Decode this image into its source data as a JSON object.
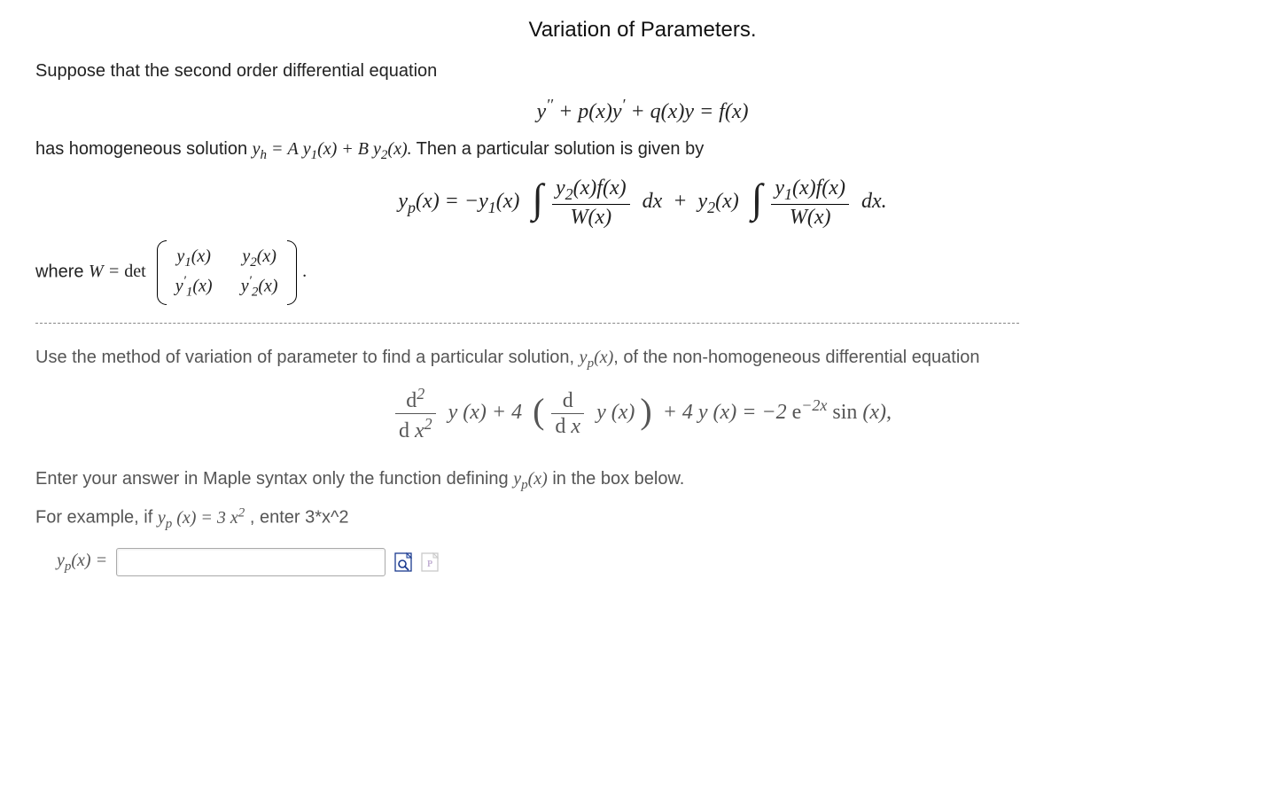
{
  "title": "Variation of Parameters.",
  "intro": {
    "line1_a": "Suppose that the second order differential equation",
    "ode": "y″ + p(x)y′ + q(x)y = f(x)",
    "line2_a": "has homogeneous solution ",
    "line2_math": "y_h = A y₁(x) + B y₂(x).",
    "line2_b": " Then a particular solution is given by",
    "yp_left": "y_p(x) = −y₁(x) ",
    "frac1_num": "y₂(x)f(x)",
    "frac1_den": "W(x)",
    "dx": " dx ",
    "plus": " + ",
    "y2x": " y₂(x) ",
    "frac2_num": "y₁(x)f(x)",
    "frac2_den": "W(x)",
    "dot": ".",
    "where_a": "where ",
    "where_math_w": "W = ",
    "det_label": "det",
    "m11": "y₁(x)",
    "m12": "y₂(x)",
    "m21": "y′₁(x)",
    "m22": "y′₂(x)",
    "where_end": "."
  },
  "question": {
    "line1": "Use the method of variation of parameter to find a particular solution, ",
    "ypx": "y_p(x)",
    "line1b": ", of the non-homogeneous differential equation",
    "d2_num": "d²",
    "d2_den": "d x²",
    "yx": " y (x) + 4 ",
    "d1_num": "d",
    "d1_den": "d x",
    "yx2": " y (x)",
    "rest": " + 4 y (x) = −2 e",
    "exp": "−2x",
    "sin": " sin (x),",
    "line2a": "Enter your answer in Maple syntax only the function defining ",
    "line2b": "  in the box below.",
    "line3a": "For example, if ",
    "ex_math": "y_p (x) = 3 x²",
    "line3b": " , enter 3*x^2",
    "prompt": "y_p(x) = ",
    "input_value": "",
    "input_placeholder": ""
  }
}
